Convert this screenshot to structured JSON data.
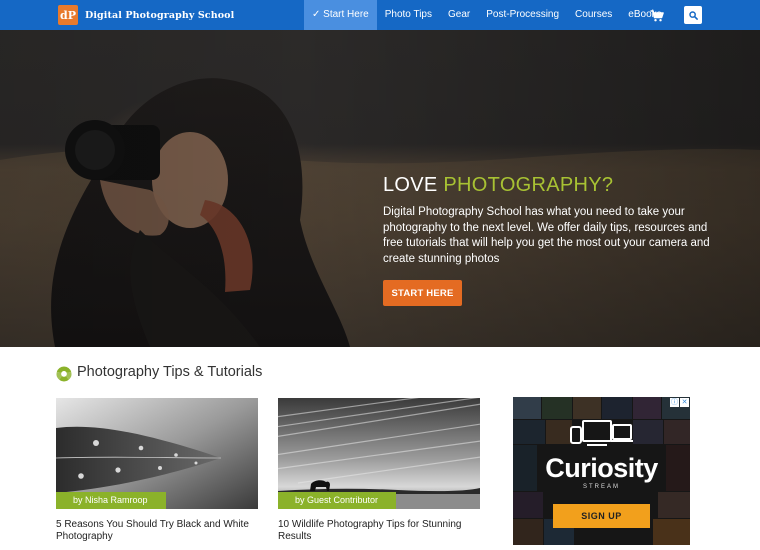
{
  "nav": {
    "brand_logo": "dP",
    "brand_name": "Digital Photography School",
    "items": [
      {
        "label": "✓ Start Here",
        "active": true
      },
      {
        "label": "Photo Tips",
        "active": false
      },
      {
        "label": "Gear",
        "active": false
      },
      {
        "label": "Post-Processing",
        "active": false
      },
      {
        "label": "Courses",
        "active": false
      },
      {
        "label": "eBooks",
        "active": false
      }
    ],
    "cart_icon": "cart-icon",
    "search_icon": "search-icon"
  },
  "hero": {
    "title_part1": "LOVE ",
    "title_part2": "PHOTOGRAPHY?",
    "description": "Digital Photography School has what you need to take your photography to the next level. We offer daily tips, resources and free tutorials that will help you get the most out your camera and create stunning photos",
    "button_label": "START HERE"
  },
  "section": {
    "title": "Photography Tips & Tutorials",
    "icon": "aperture-icon"
  },
  "cards": [
    {
      "author": "by Nisha Ramroop",
      "title": "5 Reasons You Should Try Black and White Photography"
    },
    {
      "author": "by Guest Contributor",
      "title": "10 Wildlife Photography Tips for Stunning Results"
    }
  ],
  "ad": {
    "brand": "Curiosity",
    "sub": "STREAM",
    "button_label": "SIGN UP"
  },
  "colors": {
    "nav_bg": "#1568c5",
    "accent_green": "#a8c233",
    "button_orange": "#e46b22",
    "author_green": "#8bb22a"
  }
}
